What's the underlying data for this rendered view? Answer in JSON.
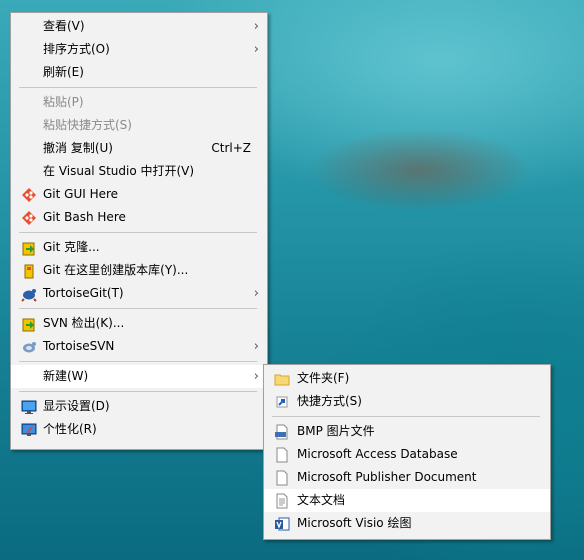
{
  "context_menu": {
    "view": "查看(V)",
    "sort": "排序方式(O)",
    "refresh": "刷新(E)",
    "paste": "粘贴(P)",
    "paste_shortcut": "粘贴快捷方式(S)",
    "undo": "撤消 复制(U)",
    "undo_shortcut": "Ctrl+Z",
    "open_vs": "在 Visual Studio 中打开(V)",
    "git_gui": "Git GUI Here",
    "git_bash": "Git Bash Here",
    "git_clone": "Git 克隆...",
    "git_create_repo": "Git 在这里创建版本库(Y)...",
    "tortoisegit": "TortoiseGit(T)",
    "svn_checkout": "SVN 检出(K)...",
    "tortoisesvn": "TortoiseSVN",
    "new": "新建(W)",
    "display_settings": "显示设置(D)",
    "personalize": "个性化(R)"
  },
  "submenu_new": {
    "folder": "文件夹(F)",
    "shortcut": "快捷方式(S)",
    "bmp": "BMP 图片文件",
    "access": "Microsoft Access Database",
    "publisher": "Microsoft Publisher Document",
    "text": "文本文档",
    "visio": "Microsoft Visio 绘图"
  },
  "icons": {
    "git_gui": "git-diamond-icon",
    "git_bash": "git-diamond-icon",
    "git_clone": "tortoisegit-clone-icon",
    "git_create_repo": "tortoisegit-repo-icon",
    "tortoisegit": "tortoisegit-icon",
    "svn_checkout": "svn-checkout-icon",
    "tortoisesvn": "tortoisesvn-icon",
    "display_settings": "monitor-icon",
    "personalize": "personalize-icon",
    "folder": "folder-icon",
    "shortcut": "shortcut-icon",
    "bmp": "bmp-file-icon",
    "access": "blank-file-icon",
    "publisher": "blank-file-icon",
    "text": "text-file-icon",
    "visio": "visio-icon"
  }
}
